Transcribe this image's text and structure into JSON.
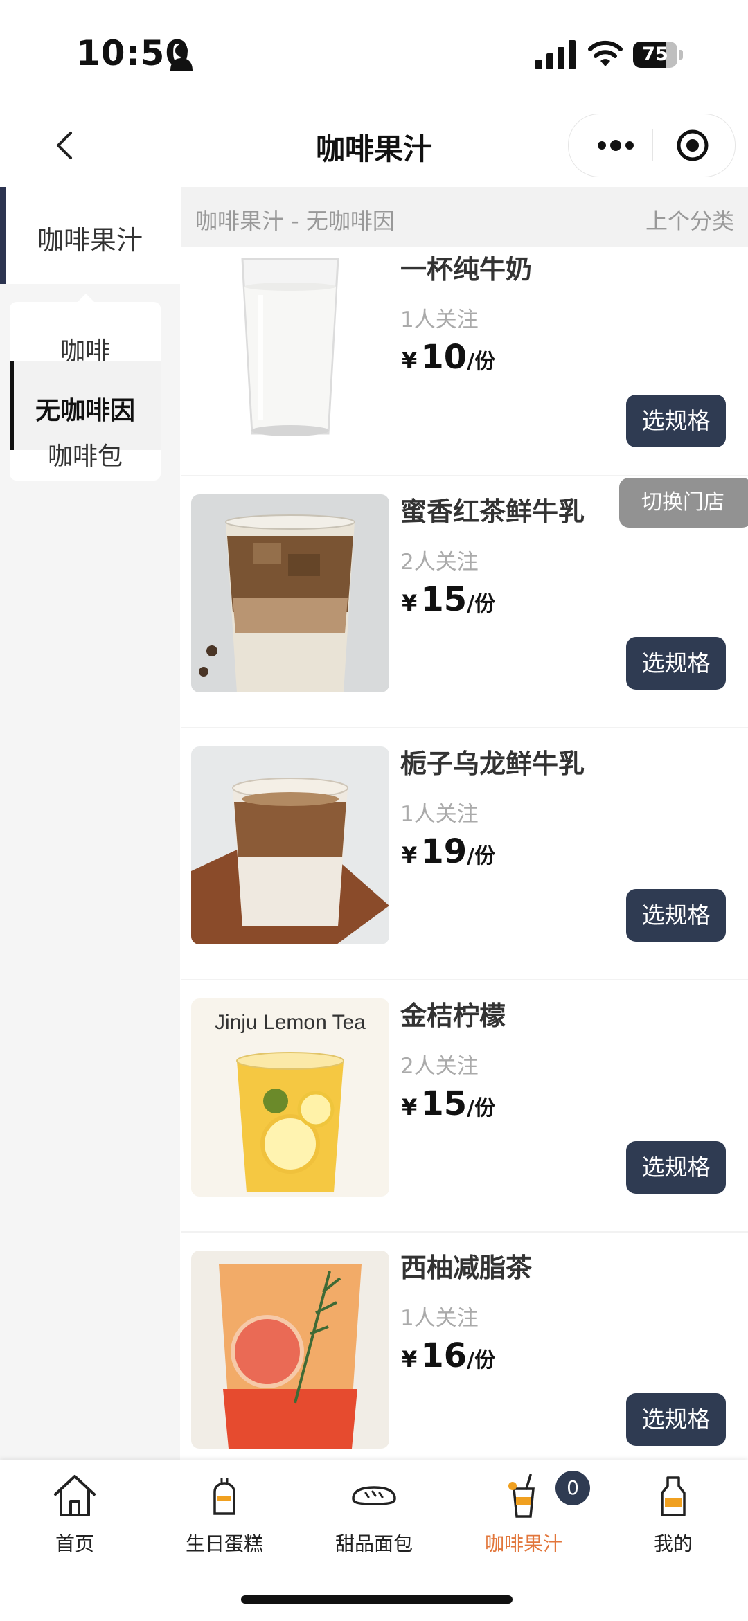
{
  "status_bar": {
    "time": "10:50",
    "battery": "75",
    "battery_level": 0.75
  },
  "nav": {
    "title": "咖啡果汁"
  },
  "sidebar": {
    "main_category": "咖啡果汁",
    "subcategories": [
      {
        "label": "咖啡",
        "active": false
      },
      {
        "label": "无咖啡因",
        "active": true
      },
      {
        "label": "咖啡包",
        "active": false
      }
    ]
  },
  "content": {
    "section_title": "咖啡果汁 - 无咖啡因",
    "prev_category": "上个分类",
    "currency": "¥",
    "unit": "/份",
    "spec_button": "选规格",
    "products": [
      {
        "name": "一杯纯牛奶",
        "followers": "1人关注",
        "price": "10"
      },
      {
        "name": "蜜香红茶鲜牛乳",
        "followers": "2人关注",
        "price": "15"
      },
      {
        "name": "栀子乌龙鲜牛乳",
        "followers": "1人关注",
        "price": "19"
      },
      {
        "name": "金桔柠檬",
        "followers": "2人关注",
        "price": "15",
        "image_text": "Jinju Lemon Tea"
      },
      {
        "name": "西柚减脂茶",
        "followers": "1人关注",
        "price": "16"
      }
    ]
  },
  "floating": {
    "switch_store": "切换门店"
  },
  "tabbar": {
    "items": [
      {
        "label": "首页",
        "icon": "home-icon"
      },
      {
        "label": "生日蛋糕",
        "icon": "cake-icon"
      },
      {
        "label": "甜品面包",
        "icon": "bread-icon"
      },
      {
        "label": "咖啡果汁",
        "icon": "drink-icon",
        "active": true
      },
      {
        "label": "我的",
        "icon": "milk-bottle-icon"
      }
    ],
    "cart_badge": "0"
  },
  "colors": {
    "accent_dark": "#2f3b52",
    "tab_active": "#e2763b"
  }
}
